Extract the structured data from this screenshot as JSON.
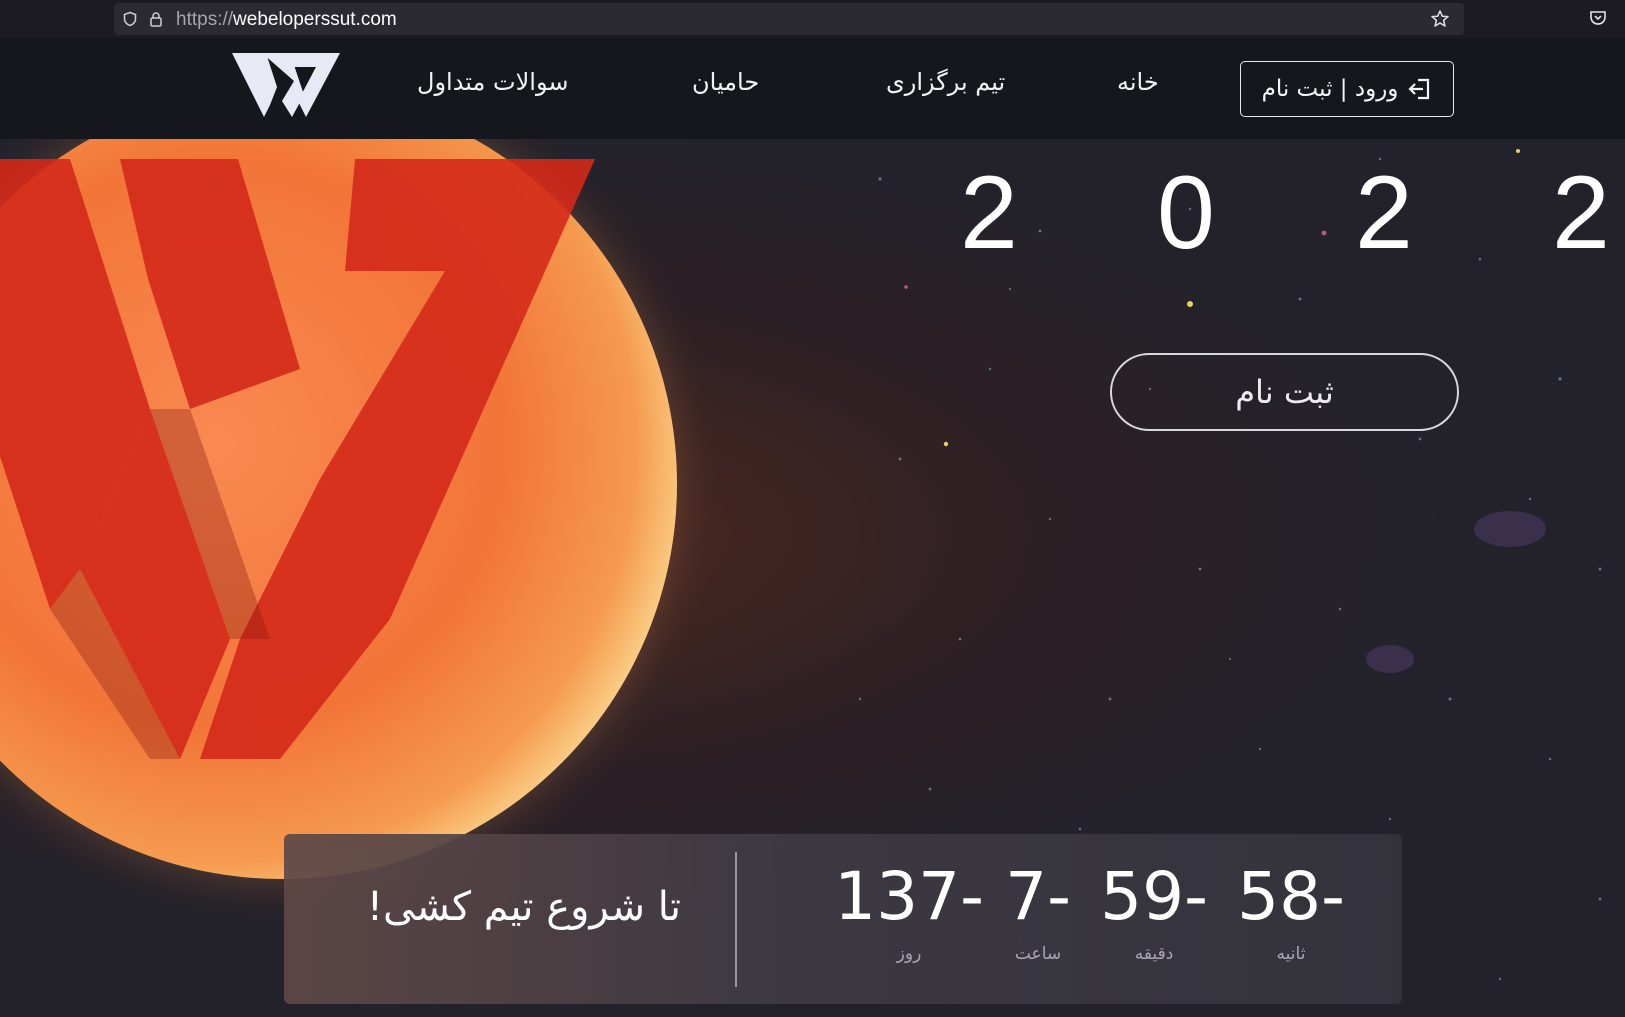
{
  "browser": {
    "url_scheme": "https://",
    "url_host": "webeloperssut.com"
  },
  "header": {
    "nav": {
      "faq": "سوالات متداول",
      "sponsors": "حامیان",
      "team": "تیم برگزاری",
      "home": "خانه"
    },
    "login_label": "ورود | ثبت نام"
  },
  "hero": {
    "year_digits": [
      "2",
      "0",
      "2",
      "2"
    ],
    "register_label": "ثبت نام",
    "countdown": {
      "title": "تا شروع تیم کشی!",
      "days": {
        "value": "137-",
        "label": "روز"
      },
      "hours": {
        "value": "7-",
        "label": "ساعت"
      },
      "minutes": {
        "value": "59-",
        "label": "دقیقه"
      },
      "seconds": {
        "value": "58-",
        "label": "ثانیه"
      }
    }
  },
  "colors": {
    "header_bg": "#16161d",
    "space_bg": "#23222b",
    "sun_orange": "#f07a3a",
    "logo_red": "#d42a1a"
  },
  "icons": [
    "shield-icon",
    "lock-icon",
    "star-icon",
    "pocket-icon",
    "login-arrow-icon",
    "w-logo"
  ]
}
